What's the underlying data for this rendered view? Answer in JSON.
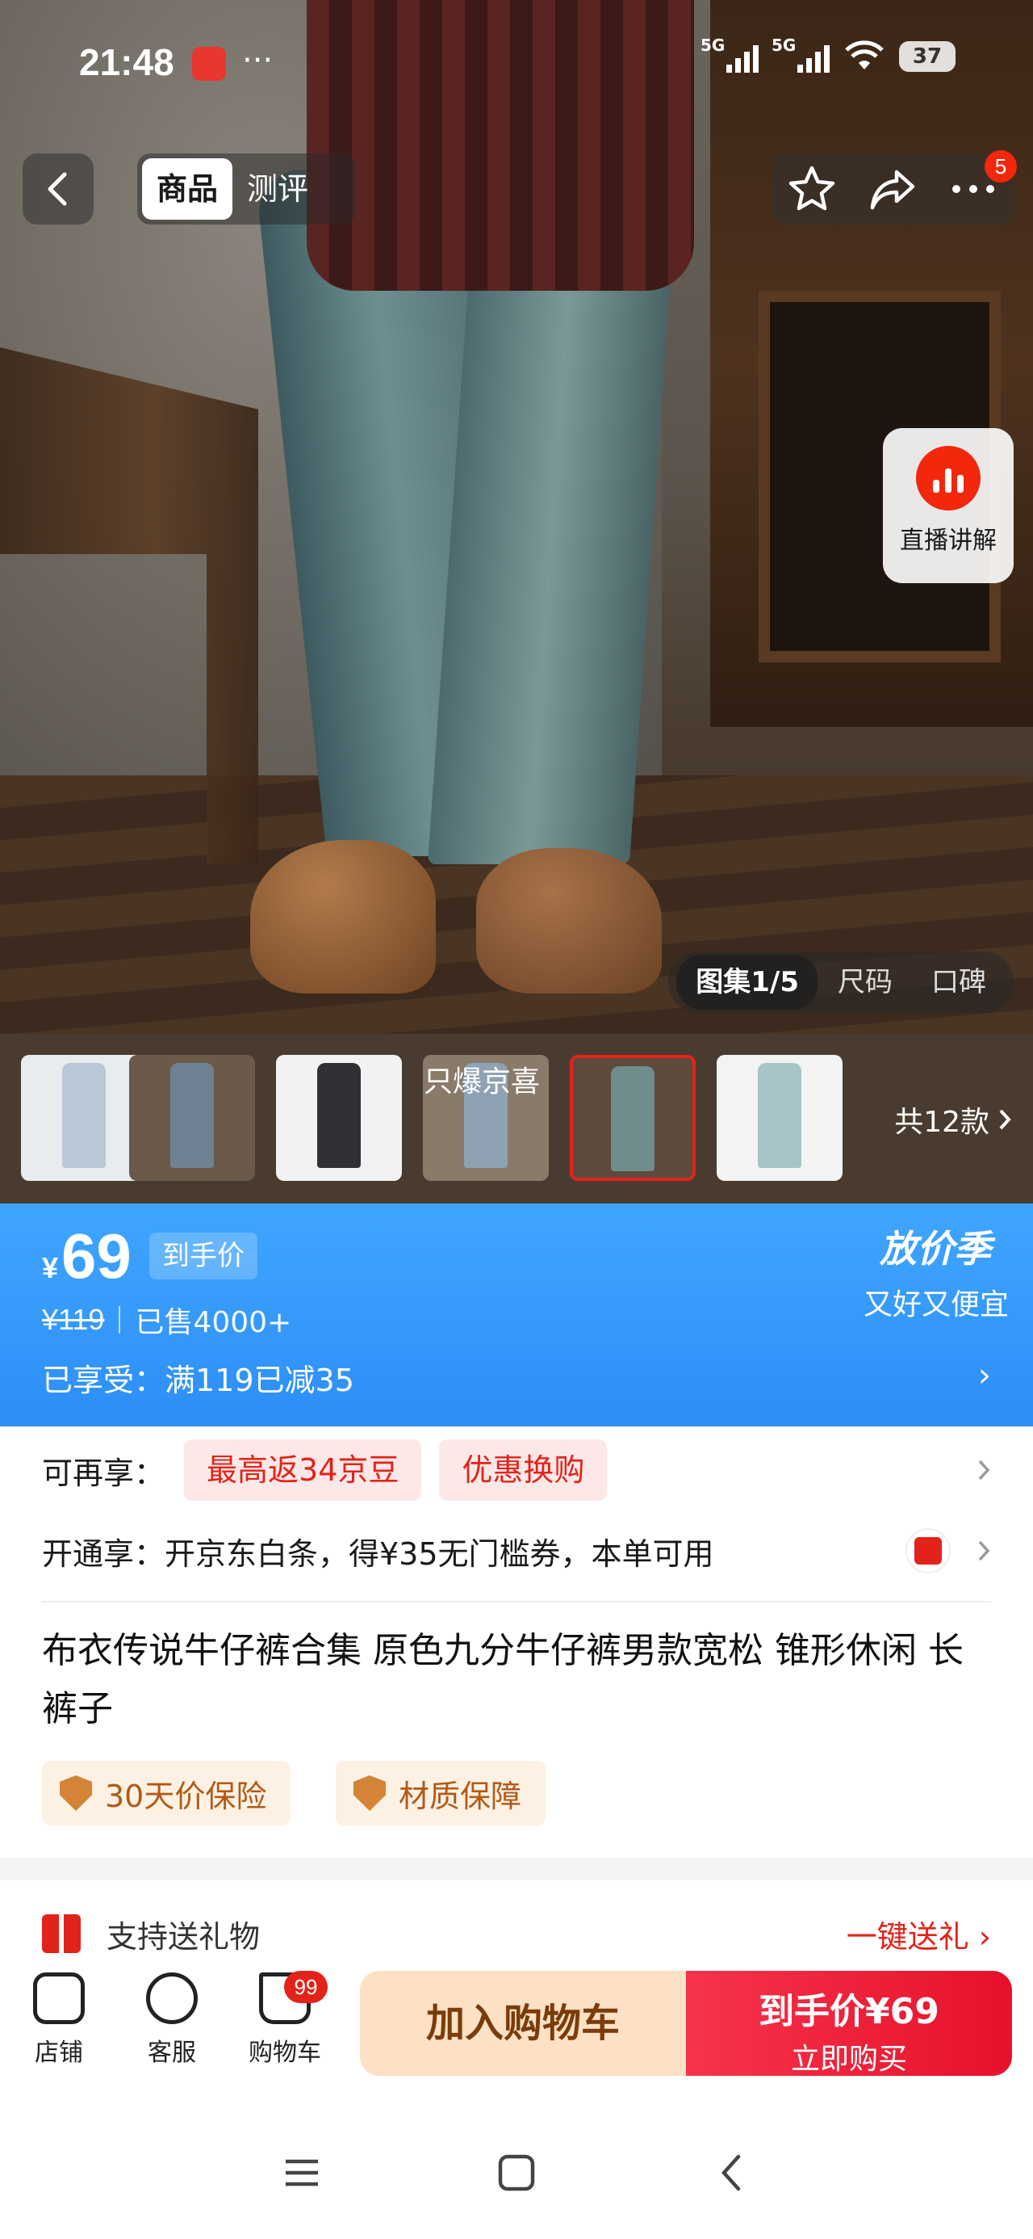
{
  "status_bar": {
    "time": "21:48",
    "more": "···",
    "network_1": "5G",
    "network_2": "5G",
    "battery": "37"
  },
  "nav": {
    "tabs": [
      {
        "label": "商品",
        "active": true
      },
      {
        "label": "测评",
        "active": false
      }
    ],
    "message_badge": "5"
  },
  "live": {
    "label": "直播讲解"
  },
  "gallery": {
    "tabs": [
      {
        "label": "图集1/5",
        "active": true
      },
      {
        "label": "尺码",
        "active": false
      },
      {
        "label": "口碑",
        "active": false
      }
    ]
  },
  "thumbnails": {
    "overlay_text": "只爆京喜",
    "total": "共12款",
    "items": [
      {
        "color": "#b9c7d6"
      },
      {
        "color": "#6f8193"
      },
      {
        "color": "#2f3134"
      },
      {
        "color": "#8ea2b3"
      },
      {
        "color": "#6f8d8c",
        "selected": true
      },
      {
        "color": "#a9c4c8"
      }
    ]
  },
  "price": {
    "currency": "¥",
    "value": "69",
    "tag": "到手价",
    "original": "¥119",
    "sold": "已售4000+",
    "enjoyed": "已享受：满119已减35",
    "chevron": "›",
    "promo_title": "放价季",
    "promo_sub": "又好又便宜"
  },
  "benefits": {
    "more_label": "可再享：",
    "chips": [
      "最高返34京豆",
      "优惠换购"
    ],
    "open_label": "开通享：开京东白条，得¥35无门槛券，本单可用"
  },
  "product": {
    "title": "布衣传说牛仔裤合集 原色九分牛仔裤男款宽松 锥形休闲 长裤子",
    "guarantees": [
      "30天价保险",
      "材质保障"
    ]
  },
  "gift": {
    "label": "支持送礼物",
    "link": "一键送礼 ›"
  },
  "bottom_bar": {
    "items": [
      "店铺",
      "客服",
      "购物车"
    ],
    "cart_badge": "99",
    "add_to_cart": "加入购物车",
    "buy_price": "到手价¥69",
    "buy_now": "立即购买"
  },
  "colors": {
    "accent_red": "#e2231a",
    "price_blue": "#2d8ef7"
  }
}
